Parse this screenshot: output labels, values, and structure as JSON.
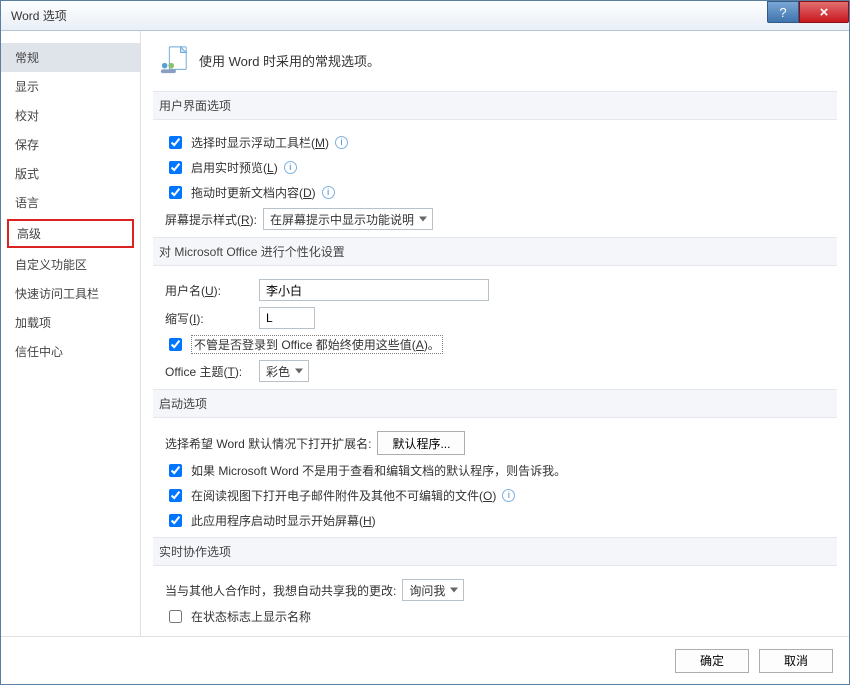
{
  "title": "Word 选项",
  "sidebar": {
    "items": [
      {
        "label": "常规",
        "selected": true
      },
      {
        "label": "显示"
      },
      {
        "label": "校对"
      },
      {
        "label": "保存"
      },
      {
        "label": "版式"
      },
      {
        "label": "语言"
      },
      {
        "label": "高级",
        "highlight": true
      },
      {
        "label": "自定义功能区"
      },
      {
        "label": "快速访问工具栏"
      },
      {
        "label": "加载项"
      },
      {
        "label": "信任中心"
      }
    ]
  },
  "header": "使用 Word 时采用的常规选项。",
  "sections": {
    "ui": {
      "title": "用户界面选项",
      "miniToolbar": {
        "checked": true,
        "label_pre": "选择时显示浮动工具栏(",
        "key": "M",
        "label_post": ")"
      },
      "livePreview": {
        "checked": true,
        "label_pre": "启用实时预览(",
        "key": "L",
        "label_post": ")"
      },
      "updateOnDrag": {
        "checked": true,
        "label_pre": "拖动时更新文档内容(",
        "key": "D",
        "label_post": ")"
      },
      "screenTipStyle": {
        "label_pre": "屏幕提示样式(",
        "key": "R",
        "label_post": "):",
        "value": "在屏幕提示中显示功能说明"
      }
    },
    "personalize": {
      "title": "对 Microsoft Office 进行个性化设置",
      "userName": {
        "label_pre": "用户名(",
        "key": "U",
        "label_post": "):",
        "value": "李小白"
      },
      "initials": {
        "label_pre": "缩写(",
        "key": "I",
        "label_post": "):",
        "value": "L"
      },
      "alwaysUse": {
        "checked": true,
        "label_pre": "不管是否登录到 Office 都始终使用这些值(",
        "key": "A",
        "label_post": ")。"
      },
      "theme": {
        "label_pre": "Office 主题(",
        "key": "T",
        "label_post": "):",
        "value": "彩色"
      }
    },
    "startup": {
      "title": "启动选项",
      "extLabel": "选择希望 Word 默认情况下打开扩展名:",
      "defaultPrograms": "默认程序...",
      "tellDefault": {
        "checked": true,
        "label": "如果 Microsoft Word 不是用于查看和编辑文档的默认程序，则告诉我。"
      },
      "openAttachments": {
        "checked": true,
        "label_pre": "在阅读视图下打开电子邮件附件及其他不可编辑的文件(",
        "key": "O",
        "label_post": ")"
      },
      "showStart": {
        "checked": true,
        "label_pre": "此应用程序启动时显示开始屏幕(",
        "key": "H",
        "label_post": ")"
      }
    },
    "collab": {
      "title": "实时协作选项",
      "shareChanges": {
        "label": "当与其他人合作时，我想自动共享我的更改:",
        "value": "询问我"
      },
      "showNames": {
        "checked": false,
        "label": "在状态标志上显示名称"
      }
    }
  },
  "footer": {
    "ok": "确定",
    "cancel": "取消"
  }
}
